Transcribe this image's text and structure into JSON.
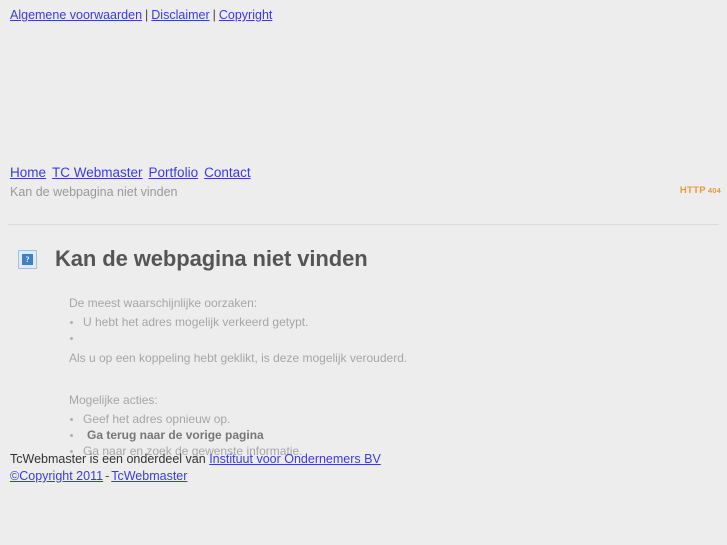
{
  "colors": {
    "background": "#ededed",
    "link": "#3b3bdd",
    "status": "#e8993a",
    "heading": "#555555",
    "muted": "#a6a6a6",
    "breadcrumb": "#999999"
  },
  "top_bar": {
    "links": [
      {
        "label": "Algemene voorwaarden"
      },
      {
        "label": "Disclaimer"
      },
      {
        "label": "Copyright"
      }
    ],
    "separator": "|"
  },
  "nav": {
    "items": [
      {
        "label": "Home"
      },
      {
        "label": "TC Webmaster"
      },
      {
        "label": "Portfolio"
      },
      {
        "label": "Contact"
      }
    ]
  },
  "breadcrumb": {
    "text": "Kan de webpagina niet vinden"
  },
  "status": {
    "label": "HTTP",
    "code": "404"
  },
  "error": {
    "icon": "broken-image-icon",
    "icon_glyph": "?",
    "title": "Kan de webpagina niet vinden",
    "causes_lead": "De meest waarschijnlijke oorzaken:",
    "causes": [
      "U hebt het adres mogelijk verkeerd getypt.",
      ""
    ],
    "causes_note": "Als u op een koppeling hebt geklikt, is deze mogelijk verouderd.",
    "actions_lead": "Mogelijke acties:",
    "actions": [
      "Geef het adres opnieuw op.",
      "Ga terug naar de vorige pagina",
      "Ga naar en zoek de gewenste informatie."
    ]
  },
  "footer": {
    "owner_text": "TcWebmaster is een onderdeel van",
    "parent_link": "Instituut voor Ondernemers BV",
    "copyright_link": "©Copyright 2011",
    "dash": "-",
    "site_link": "TcWebmaster"
  }
}
